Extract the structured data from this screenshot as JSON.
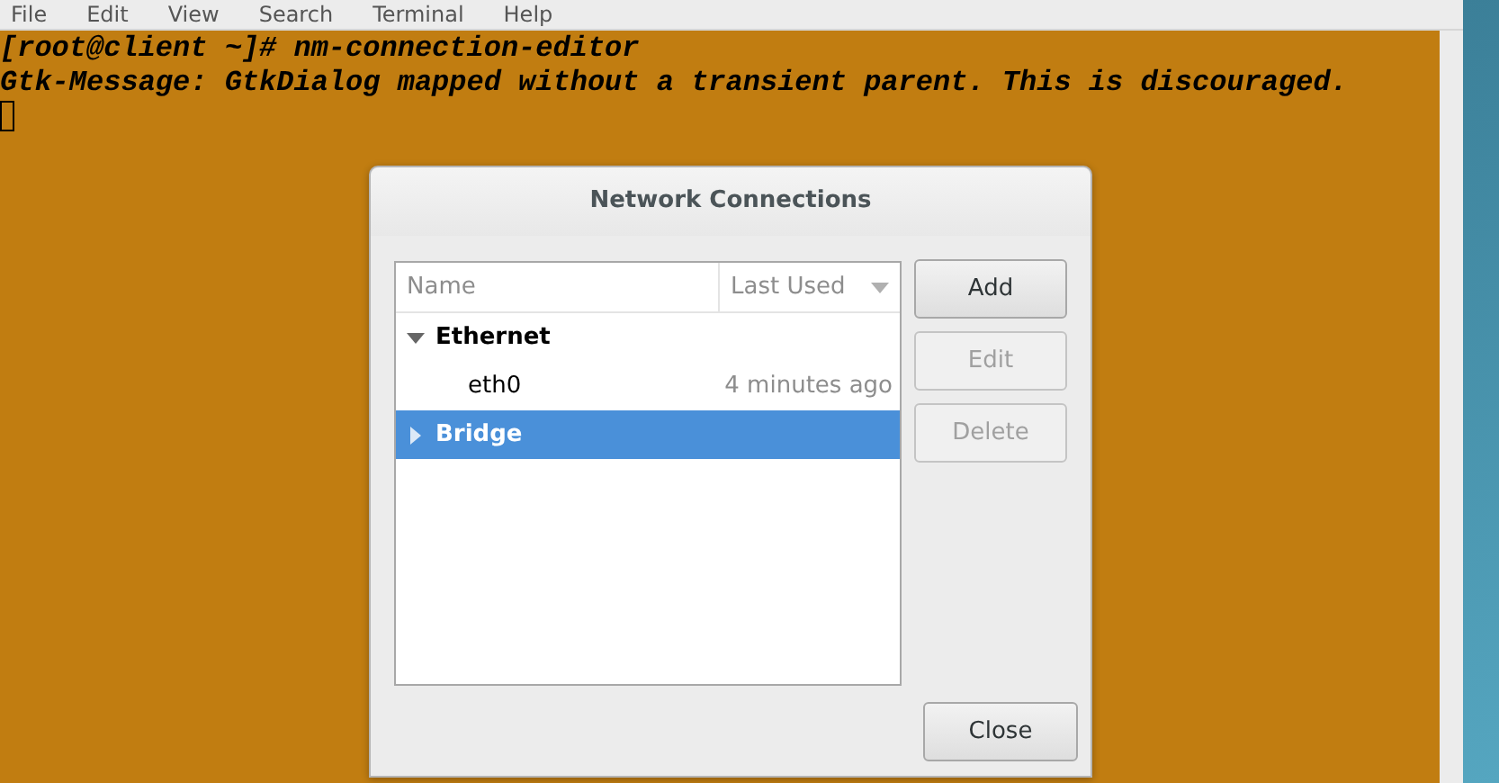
{
  "menu": [
    "File",
    "Edit",
    "View",
    "Search",
    "Terminal",
    "Help"
  ],
  "terminal": {
    "lines": [
      "[root@client ~]# nm-connection-editor",
      "Gtk-Message: GtkDialog mapped without a transient parent. This is discouraged."
    ]
  },
  "dialog": {
    "title": "Network Connections",
    "columns": [
      "Name",
      "Last Used"
    ],
    "rows": [
      {
        "name": "Ethernet",
        "expanded": true,
        "selected": false,
        "children": [
          {
            "name": "eth0",
            "last_used": "4 minutes ago",
            "selected": false
          }
        ]
      },
      {
        "name": "Bridge",
        "expanded": false,
        "selected": true
      }
    ],
    "buttons": [
      {
        "label": "Add",
        "disabled": false
      },
      {
        "label": "Edit",
        "disabled": true
      },
      {
        "label": "Delete",
        "disabled": true
      }
    ],
    "close": "Close"
  }
}
